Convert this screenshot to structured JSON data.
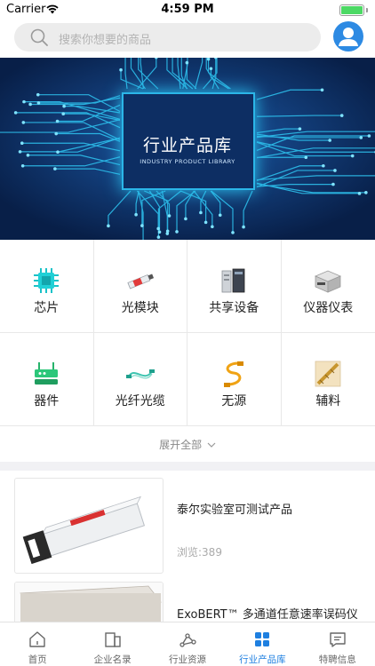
{
  "status_bar": {
    "carrier": "Carrier",
    "time": "4:59 PM",
    "battery_level": 1.0,
    "battery_color": "#4cd964"
  },
  "search": {
    "placeholder": "搜索你想要的商品",
    "icon": "search-icon"
  },
  "header": {
    "avatar_icon": "user-avatar-icon",
    "avatar_color": "#2d8ae3"
  },
  "banner": {
    "title": "行业产品库",
    "subtitle": "INDUSTRY PRODUCT LIBRARY"
  },
  "categories": [
    {
      "label": "芯片",
      "icon": "chip-icon"
    },
    {
      "label": "光模块",
      "icon": "optical-module-icon"
    },
    {
      "label": "共享设备",
      "icon": "shared-equipment-icon"
    },
    {
      "label": "仪器仪表",
      "icon": "instrument-icon"
    },
    {
      "label": "器件",
      "icon": "device-icon"
    },
    {
      "label": "光纤光缆",
      "icon": "fiber-cable-icon"
    },
    {
      "label": "无源",
      "icon": "passive-icon"
    },
    {
      "label": "辅料",
      "icon": "accessories-icon"
    }
  ],
  "expand_all": "展开全部",
  "products": [
    {
      "title": "泰尔实验室可测试产品",
      "views": "浏览:389"
    },
    {
      "title": "ExoBERT™ 多通道任意速率误码仪",
      "views": ""
    }
  ],
  "tabs": [
    {
      "label": "首页",
      "icon": "home-icon",
      "active": false
    },
    {
      "label": "企业名录",
      "icon": "directory-icon",
      "active": false
    },
    {
      "label": "行业资源",
      "icon": "resource-icon",
      "active": false
    },
    {
      "label": "行业产品库",
      "icon": "product-library-icon",
      "active": true
    },
    {
      "label": "特聘信息",
      "icon": "message-icon",
      "active": false
    }
  ],
  "colors": {
    "accent": "#1e7fe0",
    "banner_bg": "#0a2a5a",
    "banner_glow": "#2bb6e8"
  }
}
